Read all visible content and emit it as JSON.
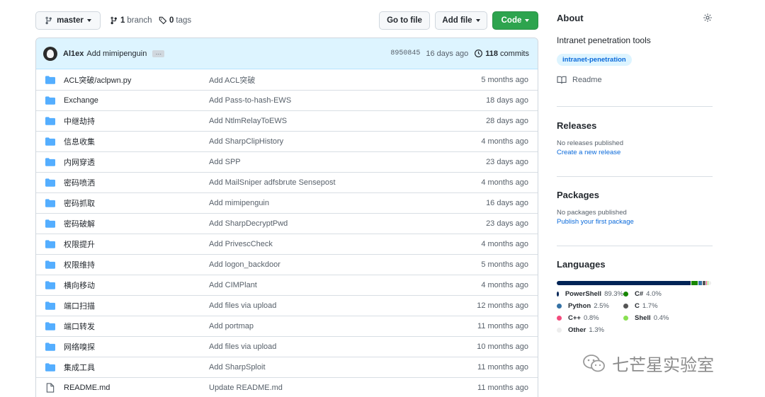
{
  "topbar": {
    "branch_label": "master",
    "branch_count": "1",
    "branch_word": "branch",
    "tag_count": "0",
    "tag_word": "tags",
    "go_to_file": "Go to file",
    "add_file": "Add file",
    "code": "Code"
  },
  "commit": {
    "author": "Al1ex",
    "message": "Add mimipenguin",
    "ellipsis": "…",
    "sha": "8950845",
    "age": "16 days ago",
    "count": "118",
    "count_word": "commits"
  },
  "files": [
    {
      "type": "folder",
      "name": "ACL突破/aclpwn.py",
      "message": "Add ACL突破",
      "age": "5 months ago"
    },
    {
      "type": "folder",
      "name": "Exchange",
      "message": "Add Pass-to-hash-EWS",
      "age": "18 days ago"
    },
    {
      "type": "folder",
      "name": "中继劫持",
      "message": "Add NtlmRelayToEWS",
      "age": "28 days ago"
    },
    {
      "type": "folder",
      "name": "信息收集",
      "message": "Add SharpClipHistory",
      "age": "4 months ago"
    },
    {
      "type": "folder",
      "name": "内网穿透",
      "message": "Add SPP",
      "age": "23 days ago"
    },
    {
      "type": "folder",
      "name": "密码喷洒",
      "message": "Add MailSniper adfsbrute Sensepost",
      "age": "4 months ago"
    },
    {
      "type": "folder",
      "name": "密码抓取",
      "message": "Add mimipenguin",
      "age": "16 days ago"
    },
    {
      "type": "folder",
      "name": "密码破解",
      "message": "Add SharpDecryptPwd",
      "age": "23 days ago"
    },
    {
      "type": "folder",
      "name": "权限提升",
      "message": "Add PrivescCheck",
      "age": "4 months ago"
    },
    {
      "type": "folder",
      "name": "权限维持",
      "message": "Add logon_backdoor",
      "age": "5 months ago"
    },
    {
      "type": "folder",
      "name": "横向移动",
      "message": "Add CIMPlant",
      "age": "4 months ago"
    },
    {
      "type": "folder",
      "name": "端口扫描",
      "message": "Add files via upload",
      "age": "12 months ago"
    },
    {
      "type": "folder",
      "name": "端口转发",
      "message": "Add portmap",
      "age": "11 months ago"
    },
    {
      "type": "folder",
      "name": "网络嗅探",
      "message": "Add files via upload",
      "age": "10 months ago"
    },
    {
      "type": "folder",
      "name": "集成工具",
      "message": "Add SharpSploit",
      "age": "11 months ago"
    },
    {
      "type": "file",
      "name": "README.md",
      "message": "Update README.md",
      "age": "11 months ago"
    }
  ],
  "about": {
    "title": "About",
    "description": "Intranet penetration tools",
    "topic": "intranet-penetration",
    "readme": "Readme"
  },
  "releases": {
    "title": "Releases",
    "none": "No releases published",
    "link": "Create a new release"
  },
  "packages": {
    "title": "Packages",
    "none": "No packages published",
    "link": "Publish your first package"
  },
  "languages": {
    "title": "Languages",
    "items": [
      {
        "name": "PowerShell",
        "pct": "89.3%",
        "value": 89.3,
        "color": "#012456"
      },
      {
        "name": "C#",
        "pct": "4.0%",
        "value": 4.0,
        "color": "#178600"
      },
      {
        "name": "Python",
        "pct": "2.5%",
        "value": 2.5,
        "color": "#3572A5"
      },
      {
        "name": "C",
        "pct": "1.7%",
        "value": 1.7,
        "color": "#555555"
      },
      {
        "name": "C++",
        "pct": "0.8%",
        "value": 0.8,
        "color": "#f34b7d"
      },
      {
        "name": "Shell",
        "pct": "0.4%",
        "value": 0.4,
        "color": "#89e051"
      },
      {
        "name": "Other",
        "pct": "1.3%",
        "value": 1.3,
        "color": "#ededed"
      }
    ]
  },
  "watermark": {
    "text": "七芒星实验室",
    "icon": "wechat-icon"
  },
  "colors": {
    "accent": "#0969da",
    "code_button": "#2da44e",
    "folder": "#54aeff"
  }
}
